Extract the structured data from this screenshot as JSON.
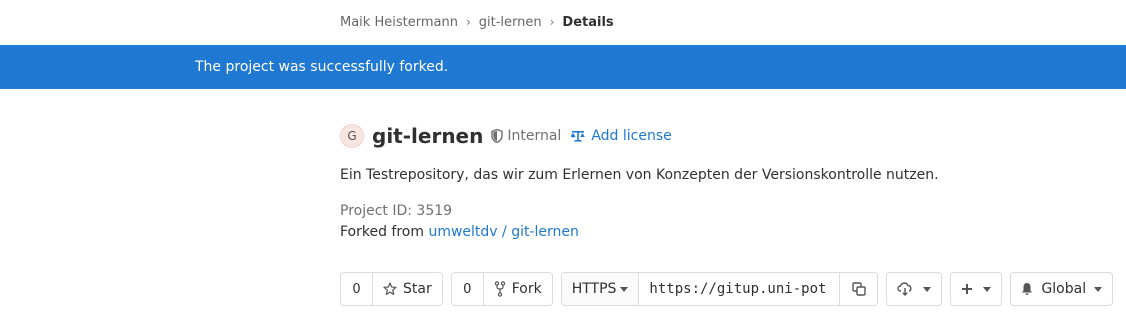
{
  "breadcrumb": {
    "items": [
      "Maik Heistermann",
      "git-lernen"
    ],
    "current": "Details"
  },
  "flash": {
    "message": "The project was successfully forked."
  },
  "project": {
    "avatar_letter": "G",
    "name": "git-lernen",
    "visibility": "Internal",
    "add_license": "Add license",
    "description": "Ein Testrepository, das wir zum Erlernen von Konzepten der Versionskontrolle nutzen.",
    "project_id_label": "Project ID: 3519",
    "forked_from_prefix": "Forked from",
    "forked_from_link": "umweltdv / git-lernen"
  },
  "actions": {
    "star_count": "0",
    "star_label": "Star",
    "fork_count": "0",
    "fork_label": "Fork",
    "clone_protocol": "HTTPS",
    "clone_url": "https://gitup.uni-pot",
    "notification_label": "Global"
  },
  "colors": {
    "accent": "#1f78d1",
    "flash_bg": "#1f78d1",
    "text": "#303030",
    "muted": "#707070",
    "border": "#dbdbdb"
  }
}
